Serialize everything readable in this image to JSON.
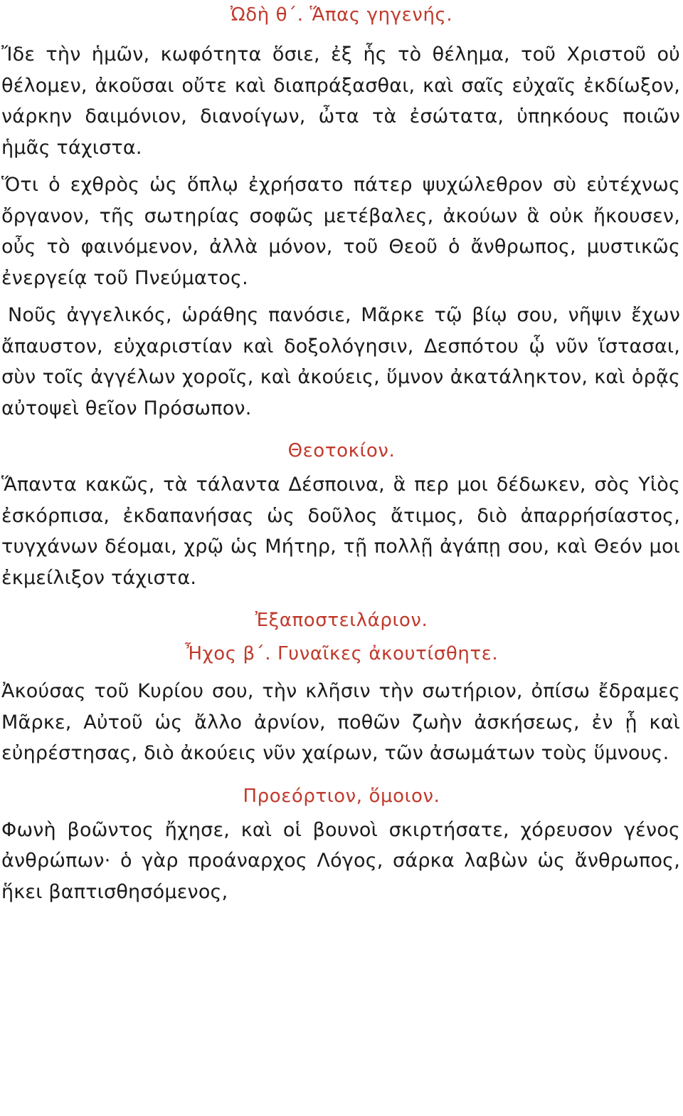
{
  "document": {
    "language": "Greek (polytonic)",
    "type": "liturgical-service-text",
    "text_color": "#1a1a1a",
    "rubric_color": "#c0392b",
    "background_color": "#ffffff"
  },
  "headings": {
    "ode_nine": "Ὠδὴ θ΄. Ἅπας γηγενής.",
    "theotokion": "Θεοτοκίον.",
    "exaposteilarion": "Ἐξαποστειλάριον.",
    "mode_and_prosomoion": "Ἦχος β΄. Γυναῖκες ἀκουτίσθητε.",
    "proeortion": "Προεόρτιον, ὅμοιον."
  },
  "troparia": {
    "first": "Ἴδε τὴν ἡμῶν, κωφότητα ὅσιε, ἐξ ἧς τὸ θέλημα, τοῦ Χριστοῦ οὐ θέλομεν, ἀκοῦσαι οὔτε καὶ διαπράξασθαι, καὶ σαῖς εὐχαῖς ἐκδίωξον, νάρκην δαιμόνιον, διανοίγων, ὦτα τὰ ἐσώτατα, ὑπηκόους ποιῶν ἡμᾶς τάχιστα.",
    "second": "Ὅτι ὁ εχθρὸς ὡς ὅπλῳ ἐχρήσατο πάτερ ψυχώλεθρον σὺ εὐτέχνως ὄργανον, τῆς σωτηρίας σοφῶς μετέβαλες, ἀκούων ἃ οὐκ ἤκουσεν, οὖς τὸ φαινόμενον, ἀλλὰ μόνον, τοῦ Θεοῦ ὁ ἄνθρωπος, μυστικῶς ἐνεργείᾳ τοῦ Πνεύματος.",
    "third": "Νοῦς ἀγγελικός, ὡράθης πανόσιε, Μᾶρκε τῷ βίῳ σου, νῆψιν ἔχων ἄπαυστον, εὐχαριστίαν καὶ δοξολόγησιν, Δεσπότου ᾧ νῦν ἵστασαι, σὺν τοῖς ἀγγέλων χοροῖς, καὶ ἀκούεις, ὕμνον ἀκατάληκτον, καὶ ὁρᾷς αὐτοψεὶ θεῖον Πρόσωπον.",
    "theotokion_text": "Ἅπαντα κακῶς, τὰ τάλαντα Δέσποινα, ἃ περ μοι δέδωκεν, σὸς Υἱὸς ἐσκόρπισα, ἐκδαπανήσας ὡς δοῦλος ἄτιμος, διὸ ἀπαρρήσίαστος, τυγχάνων δέομαι, χρῷ ὡς Μήτηρ, τῇ πολλῇ ἀγάπῃ σου, καὶ Θεόν μοι ἐκμείλιξον τάχιστα.",
    "exaposteilarion_text": "Ἀκούσας τοῦ Κυρίου σου, τὴν κλῆσιν τὴν σωτήριον, ὀπίσω ἔδραμες Μᾶρκε, Αὐτοῦ ὡς ἄλλο ἀρνίον, ποθῶν ζωὴν ἀσκήσεως, ἐν ᾗ καὶ εὐηρέστησας, διὸ ἀκούεις νῦν χαίρων, τῶν ἀσωμάτων τοὺς ὕμνους.",
    "proeortion_text": "Φωνὴ βοῶντος ἤχησε, καὶ οἱ βουνοὶ σκιρτήσατε, χόρευσον γένος ἀνθρώπων· ὁ γὰρ προάναρχος Λόγος, σάρκα λαβὼν ὡς ἄνθρωπος, ἥκει βαπτισθησόμενος,"
  }
}
